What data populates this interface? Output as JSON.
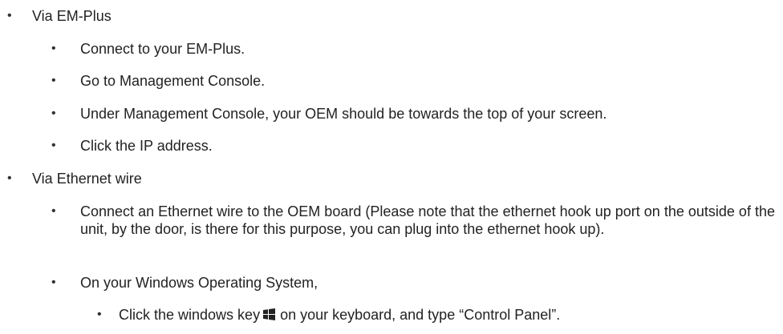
{
  "items": [
    {
      "bullet": "•",
      "text": "Via EM-Plus"
    },
    {
      "bullet": "•",
      "text": "Connect to your EM-Plus."
    },
    {
      "bullet": "•",
      "text": "Go to Management Console."
    },
    {
      "bullet": "•",
      "text": "Under Management Console, your OEM should be towards the top of your screen."
    },
    {
      "bullet": "•",
      "text": "Click the IP address."
    },
    {
      "bullet": "•",
      "text": "Via Ethernet wire"
    },
    {
      "bullet": "•",
      "text": "Connect an Ethernet wire to the OEM board (Please note that the ethernet hook up port on the outside of the unit, by the door, is there for this purpose, you can plug into the ethernet hook up)."
    },
    {
      "bullet": "•",
      "text": "On your Windows Operating System,"
    },
    {
      "bullet": "•",
      "text_before": "Click the windows key",
      "icon": "windows-logo-icon",
      "text_after": "on your keyboard, and type “Control Panel”."
    }
  ]
}
